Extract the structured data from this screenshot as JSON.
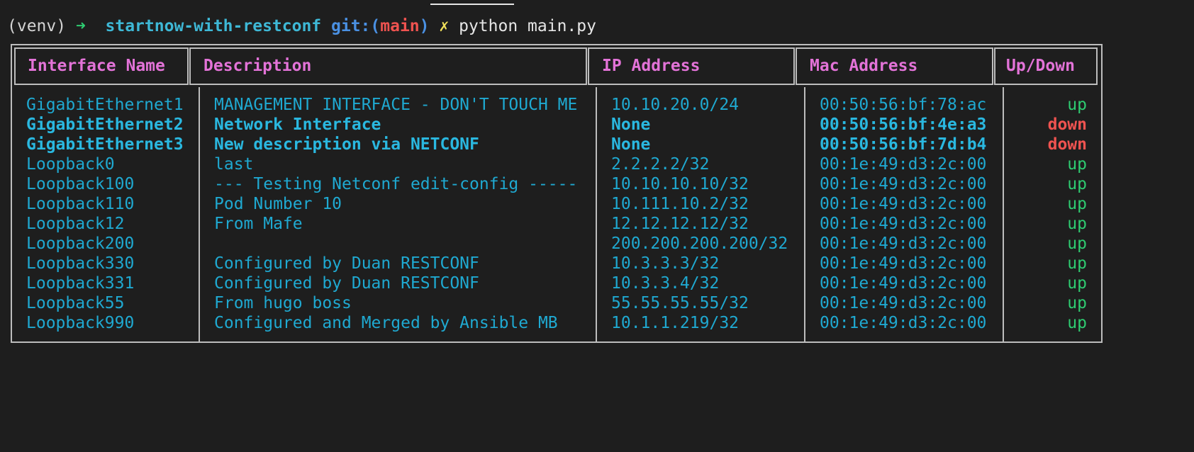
{
  "prompt": {
    "venv": "(venv)",
    "arrow": "➜",
    "directory": "startnow-with-restconf",
    "git_prefix": "git:(",
    "branch": "main",
    "git_suffix": ")",
    "dirty_marker": "✗",
    "command": "python main.py"
  },
  "table": {
    "headers": {
      "name": "Interface Name",
      "description": "Description",
      "ip": "IP Address",
      "mac": "Mac Address",
      "status": "Up/Down"
    },
    "rows": [
      {
        "name": "GigabitEthernet1",
        "description": "MANAGEMENT INTERFACE - DON'T TOUCH ME",
        "ip": "10.10.20.0/24",
        "mac": "00:50:56:bf:78:ac",
        "status": "up"
      },
      {
        "name": "GigabitEthernet2",
        "description": "Network Interface",
        "ip": "None",
        "mac": "00:50:56:bf:4e:a3",
        "status": "down"
      },
      {
        "name": "GigabitEthernet3",
        "description": "New description via NETCONF",
        "ip": "None",
        "mac": "00:50:56:bf:7d:b4",
        "status": "down"
      },
      {
        "name": "Loopback0",
        "description": "last",
        "ip": "2.2.2.2/32",
        "mac": "00:1e:49:d3:2c:00",
        "status": "up"
      },
      {
        "name": "Loopback100",
        "description": "--- Testing Netconf edit-config -----",
        "ip": "10.10.10.10/32",
        "mac": "00:1e:49:d3:2c:00",
        "status": "up"
      },
      {
        "name": "Loopback110",
        "description": "Pod Number 10",
        "ip": "10.111.10.2/32",
        "mac": "00:1e:49:d3:2c:00",
        "status": "up"
      },
      {
        "name": "Loopback12",
        "description": "From Mafe",
        "ip": "12.12.12.12/32",
        "mac": "00:1e:49:d3:2c:00",
        "status": "up"
      },
      {
        "name": "Loopback200",
        "description": "",
        "ip": "200.200.200.200/32",
        "mac": "00:1e:49:d3:2c:00",
        "status": "up"
      },
      {
        "name": "Loopback330",
        "description": "Configured by Duan RESTCONF",
        "ip": "10.3.3.3/32",
        "mac": "00:1e:49:d3:2c:00",
        "status": "up"
      },
      {
        "name": "Loopback331",
        "description": "Configured by Duan RESTCONF",
        "ip": "10.3.3.4/32",
        "mac": "00:1e:49:d3:2c:00",
        "status": "up"
      },
      {
        "name": "Loopback55",
        "description": "From hugo boss",
        "ip": "55.55.55.55/32",
        "mac": "00:1e:49:d3:2c:00",
        "status": "up"
      },
      {
        "name": "Loopback990",
        "description": "Configured and Merged by Ansible MB",
        "ip": "10.1.1.219/32",
        "mac": "00:1e:49:d3:2c:00",
        "status": "up"
      }
    ]
  },
  "colors": {
    "background": "#1e1e1e",
    "header_text": "#e373d8",
    "cell_text": "#1fa9d1",
    "status_up": "#2ecc71",
    "status_down": "#ef5350",
    "border": "#bdbdbd"
  }
}
